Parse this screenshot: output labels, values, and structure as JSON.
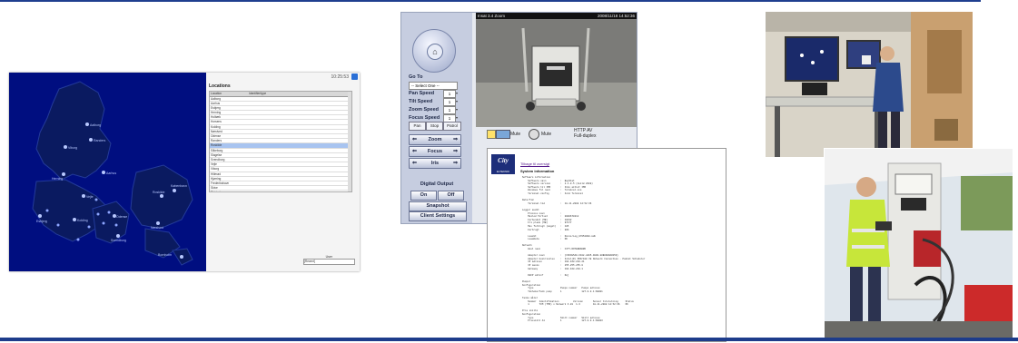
{
  "map_app": {
    "clock": "10:25:53",
    "locations_title": "Locations",
    "table_headers": [
      "Location",
      "Identifier/type"
    ],
    "rows": [
      "Aalborg",
      "Aarhus",
      "Esbjerg",
      "Herning",
      "Holbæk",
      "Horsens",
      "Kolding",
      "Næstved",
      "Odense",
      "Randers",
      "Roskilde",
      "Silkeborg",
      "Slagelse",
      "Svendborg",
      "Vejle",
      "Viborg",
      "Hillerød",
      "Hjørring",
      "Frederikshavn",
      "Skive",
      "Thisted",
      "Fredericia",
      "Nyborg",
      "Ringsted"
    ],
    "selected_row_index": 10,
    "city_labels": [
      "Aalborg",
      "Viborg",
      "Randers",
      "Aarhus",
      "Herning",
      "Vejle",
      "Odense",
      "Roskilde",
      "København",
      "Esbjerg",
      "Kolding",
      "Svendborg",
      "Næstved",
      "Bornholm"
    ],
    "user_label": "User",
    "dropdown_value": "[Recent]"
  },
  "ptz": {
    "video_title": "Insat 3.4 Zoom",
    "video_timestamp": "2008/11/18 14:52:36",
    "goto_label": "Go To",
    "select_one": "-- Select One --",
    "speeds": [
      {
        "label": "Pan Speed",
        "value": "1"
      },
      {
        "label": "Tilt Speed",
        "value": "1"
      },
      {
        "label": "Zoom Speed",
        "value": "1"
      },
      {
        "label": "Focus Speed",
        "value": "1"
      }
    ],
    "small_buttons": [
      "Pan",
      "Stop",
      "Patrol"
    ],
    "zoom_label": "Zoom",
    "focus_label": "Focus",
    "iris_label": "Iris",
    "digital_output": "Digital Output",
    "on_label": "On",
    "off_label": "Off",
    "snapshot": "Snapshot",
    "client_settings": "Client Settings",
    "configuration": "Configuration",
    "mute1": "Mute",
    "mute2": "Mute",
    "http_av": "HTTP  AV",
    "full_duplex": "Full-duplex"
  },
  "sysinfo": {
    "logo_text": "City",
    "logo_sub": "ELTEKNIK",
    "link": "Tilbage til oversigt",
    "heading": "System information",
    "lines": [
      "Software information",
      "    Software navn          :  BayStat",
      "    Software version       :  2.1.0.5 (build 2008)",
      "    Software til IMO       :  Ikke aktivt IMO",
      "    Windows fil navn       :  Terminal.exe",
      "    Terminal config        :  Fuld Terminal",
      "",
      "Date/Tid",
      "    Terminal tid           :  18-11-2008 14:52:36",
      "",
      "Logger audit",
      "    Process navn           :",
      "    Mailed fortsat         :  0000670212",
      "    Forbundet (MB)         :  10432",
      "    Fri plads (MB)         :  97177",
      "    Max forbrugt (meget)   :  105",
      "    Forbrugt               :  88%",
      "",
      "    Loadit                 :  Nexis/Log_07052008.mdb",
      "    Loaddata               :  OK",
      "",
      "Netværk",
      "    Host navn              :  CITY-ROTERBOARD",
      "",
      "    Adapter navn           :  {C3DCE5A0-6102-4A05-9800-80B0DADA0050}",
      "    Adapter beskrivelse    :  Intel(R) PRO/100 VE Network Connection - Pakket Scheduler",
      "    IP adresse             :  192.168.210.21",
      "    IP maske               :  255.255.255.0",
      "    Gateway                :  192.168.210.1",
      "",
      "    DHCP aktiv?            :  Nej",
      "",
      "Pumper",
      "Konfiguration",
      "    Type                   Pumpe nummer   Pumpe adresse",
      "    Tokheim/Tank pump      1              127.0.0.1:60001",
      "",
      "Tanke måler",
      "    Nummer  Identifikation          Version       Sensor tilslutning     Status",
      "    1       TCM (TMS) v Network 3.01  1.3         18-11-2008 14:52:36    OK",
      "",
      "Pris skilte",
      "Konfiguration",
      "    Type                   Skilt nummer   Skilt adresse",
      "    Prisskilt A1           1              127.0.0.1:60003"
    ]
  }
}
